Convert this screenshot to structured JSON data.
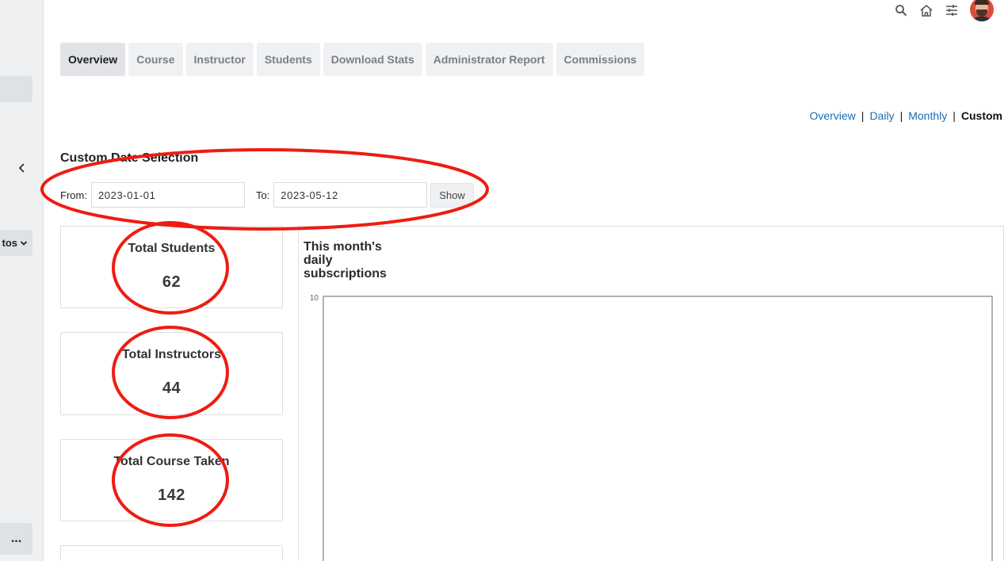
{
  "sidebar": {
    "collapse_icon": "chevron-left-icon",
    "dropdown_label": "tos",
    "dropdown_icon": "chevron-down-icon",
    "more_label": "..."
  },
  "header": {
    "icons": [
      "search-icon",
      "home-icon",
      "sliders-icon",
      "avatar"
    ]
  },
  "tabs": [
    {
      "label": "Overview",
      "active": true
    },
    {
      "label": "Course",
      "active": false
    },
    {
      "label": "Instructor",
      "active": false
    },
    {
      "label": "Students",
      "active": false
    },
    {
      "label": "Download Stats",
      "active": false
    },
    {
      "label": "Administrator Report",
      "active": false
    },
    {
      "label": "Commissions",
      "active": false
    }
  ],
  "view_links": {
    "overview": "Overview",
    "daily": "Daily",
    "monthly": "Monthly",
    "custom": "Custom",
    "separator": "|"
  },
  "custom_date": {
    "title": "Custom Date Selection",
    "from_label": "From:",
    "from_value": "2023-01-01",
    "to_label": "To:",
    "to_value": "2023-05-12",
    "show_label": "Show"
  },
  "stats": [
    {
      "label": "Total Students",
      "value": "62"
    },
    {
      "label": "Total Instructors",
      "value": "44"
    },
    {
      "label": "Total Course Taken",
      "value": "142"
    }
  ],
  "chart": {
    "title": "This month's daily subscriptions"
  },
  "chart_data": {
    "type": "line",
    "title": "This month's daily subscriptions",
    "xlabel": "",
    "ylabel": "",
    "y_tick_labels": [
      "10"
    ],
    "series": []
  },
  "colors": {
    "annotation": "#ee1c12",
    "link": "#1b6db3",
    "tab_bg": "#f0f1f3",
    "tab_active_bg": "#e2e3e6"
  }
}
